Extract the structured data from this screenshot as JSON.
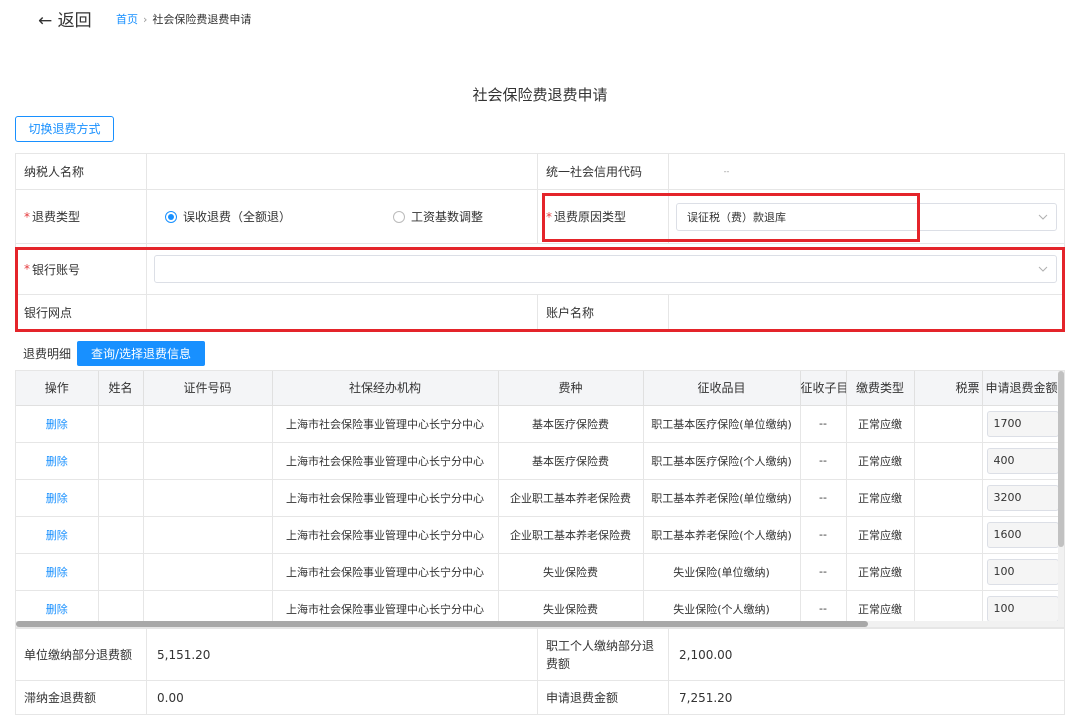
{
  "nav": {
    "back_label": "← 返回",
    "home_label": "首页",
    "separator": "›",
    "current": "社会保险费退费申请"
  },
  "page_title": "社会保险费退费申请",
  "switch_button": "切换退费方式",
  "form": {
    "taxpayer_name_label": "纳税人名称",
    "taxpayer_name_value": "",
    "credit_code_label": "统一社会信用代码",
    "credit_code_value": "--",
    "refund_type_label": "退费类型",
    "refund_type_options": [
      "误收退费（全额退）",
      "工资基数调整"
    ],
    "refund_type_selected": 0,
    "reason_type_label": "退费原因类型",
    "reason_type_value": "误征税（费）款退库",
    "bank_account_label": "银行账号",
    "bank_account_value": "",
    "bank_branch_label": "银行网点",
    "bank_branch_value": "",
    "account_name_label": "账户名称",
    "account_name_value": ""
  },
  "detail": {
    "title": "退费明细",
    "query_button": "查询/选择退费信息"
  },
  "table": {
    "columns": [
      "操作",
      "姓名",
      "证件号码",
      "社保经办机构",
      "费种",
      "征收品目",
      "征收子目",
      "缴费类型",
      "税票",
      "申请退费金额"
    ],
    "rows": [
      {
        "op": "删除",
        "name": "",
        "id": "",
        "agency": "上海市社会保险事业管理中心长宁分中心",
        "fee_type": "基本医疗保险费",
        "item": "职工基本医疗保险(单位缴纳)",
        "subitem": "--",
        "pay_type": "正常应缴",
        "ticket": "",
        "amount": "1700"
      },
      {
        "op": "删除",
        "name": "",
        "id": "",
        "agency": "上海市社会保险事业管理中心长宁分中心",
        "fee_type": "基本医疗保险费",
        "item": "职工基本医疗保险(个人缴纳)",
        "subitem": "--",
        "pay_type": "正常应缴",
        "ticket": "",
        "amount": "400"
      },
      {
        "op": "删除",
        "name": "",
        "id": "",
        "agency": "上海市社会保险事业管理中心长宁分中心",
        "fee_type": "企业职工基本养老保险费",
        "item": "职工基本养老保险(单位缴纳)",
        "subitem": "--",
        "pay_type": "正常应缴",
        "ticket": "",
        "amount": "3200"
      },
      {
        "op": "删除",
        "name": "",
        "id": "",
        "agency": "上海市社会保险事业管理中心长宁分中心",
        "fee_type": "企业职工基本养老保险费",
        "item": "职工基本养老保险(个人缴纳)",
        "subitem": "--",
        "pay_type": "正常应缴",
        "ticket": "",
        "amount": "1600"
      },
      {
        "op": "删除",
        "name": "",
        "id": "",
        "agency": "上海市社会保险事业管理中心长宁分中心",
        "fee_type": "失业保险费",
        "item": "失业保险(单位缴纳)",
        "subitem": "--",
        "pay_type": "正常应缴",
        "ticket": "",
        "amount": "100"
      },
      {
        "op": "删除",
        "name": "",
        "id": "",
        "agency": "上海市社会保险事业管理中心长宁分中心",
        "fee_type": "失业保险费",
        "item": "失业保险(个人缴纳)",
        "subitem": "--",
        "pay_type": "正常应缴",
        "ticket": "",
        "amount": "100"
      }
    ]
  },
  "summary": {
    "unit_refund_label": "单位缴纳部分退费额",
    "unit_refund_value": "5,151.20",
    "personal_refund_label": "职工个人缴纳部分退费额",
    "personal_refund_value": "2,100.00",
    "late_fee_label": "滞纳金退费额",
    "late_fee_value": "0.00",
    "total_label": "申请退费金额",
    "total_value": "7,251.20"
  },
  "colors": {
    "accent": "#1890ff",
    "highlight": "#e4242a",
    "required": "#e4393c"
  }
}
